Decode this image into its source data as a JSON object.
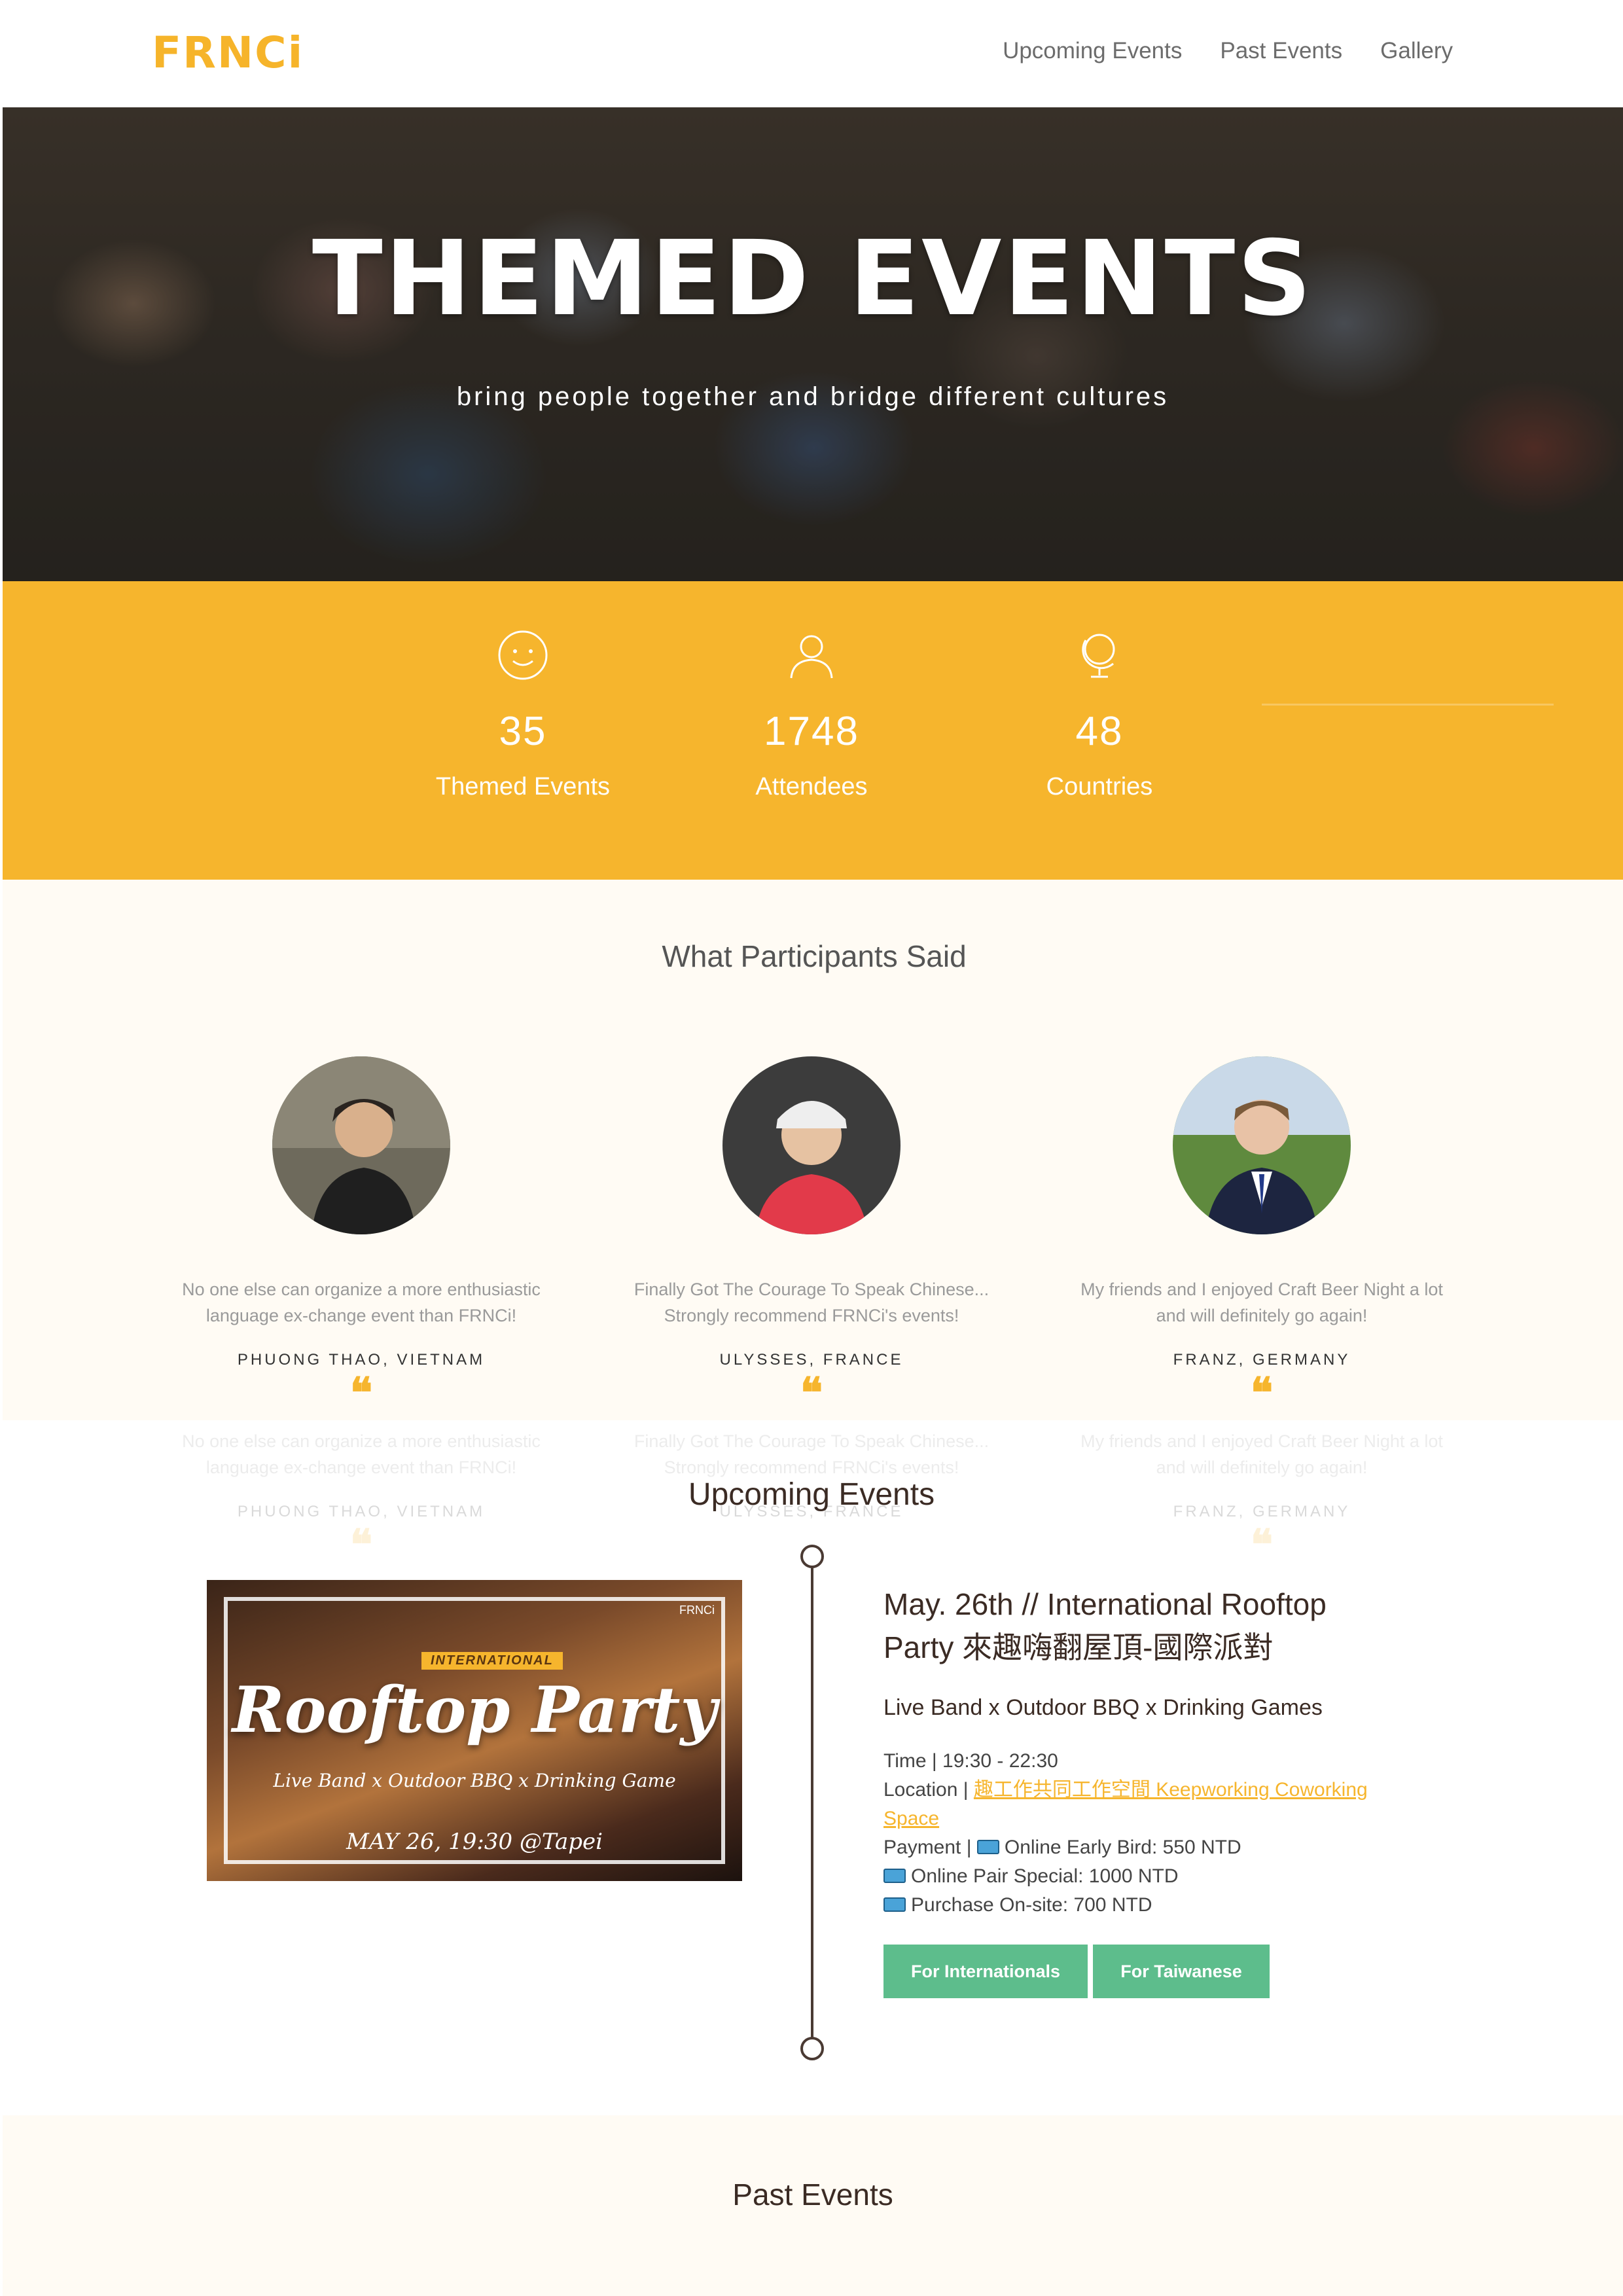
{
  "nav": {
    "logo": "FRNCi",
    "links": [
      "Upcoming Events",
      "Past Events",
      "Gallery"
    ]
  },
  "hero": {
    "title": "THEMED EVENTS",
    "subtitle": "bring people together and bridge different cultures"
  },
  "stats": [
    {
      "icon": "smile-icon",
      "value": "35",
      "label": "Themed Events"
    },
    {
      "icon": "user-icon",
      "value": "1748",
      "label": "Attendees"
    },
    {
      "icon": "globe-icon",
      "value": "48",
      "label": "Countries"
    }
  ],
  "testimonials": {
    "title": "What Participants Said",
    "items": [
      {
        "quote_line1": "No one else can organize a more enthusiastic",
        "quote_line2": "language ex-change event than FRNCi!",
        "name": "PHUONG THAO, VIETNAM"
      },
      {
        "quote_line1": "Finally Got The Courage To Speak Chinese...",
        "quote_line2": "Strongly recommend FRNCi's events!",
        "name": "ULYSSES, FRANCE"
      },
      {
        "quote_line1": "My friends and I enjoyed Craft Beer Night a lot",
        "quote_line2": "and will definitely go again!",
        "name": "FRANZ, GERMANY"
      }
    ]
  },
  "upcoming": {
    "title": "Upcoming Events",
    "poster": {
      "brand": "FRNCi",
      "tag": "INTERNATIONAL",
      "title": "Rooftop Party",
      "subtitle": "Live Band x Outdoor BBQ x Drinking Game",
      "date": "MAY 26, 19:30 @Tapei"
    },
    "event": {
      "title_line1": "May. 26th // International Rooftop",
      "title_line2": "Party 來趣嗨翻屋頂-國際派對",
      "tagline": "Live Band x Outdoor BBQ x Drinking Games",
      "time_label": "Time | ",
      "time": "19:30 - 22:30",
      "location_label": "Location | ",
      "location_link": "趣工作共同工作空間 Keepworking Coworking Space",
      "payment_label": "Payment | ",
      "payment1": "Online Early Bird: 550 NTD",
      "payment2": "Online Pair Special: 1000 NTD",
      "payment3": "Purchase On-site: 700 NTD",
      "btn_international": "For Internationals",
      "btn_taiwanese": "For Taiwanese"
    }
  },
  "past": {
    "title": "Past Events"
  },
  "colors": {
    "accent": "#f6b52d",
    "button": "#5dbd8c",
    "timeline": "#4a3a33",
    "cream": "#fffbf4"
  }
}
